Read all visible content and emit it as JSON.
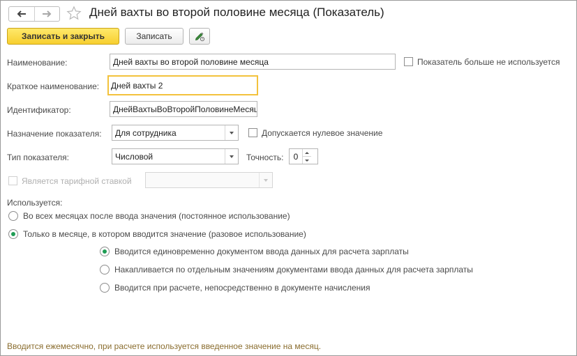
{
  "window": {
    "title": "Дней вахты во второй половине месяца (Показатель)"
  },
  "toolbar": {
    "save_close_label": "Записать и закрыть",
    "save_label": "Записать"
  },
  "form": {
    "name_label": "Наименование:",
    "name_value": "Дней вахты во второй половине месяца",
    "not_used_label": "Показатель больше не используется",
    "short_name_label": "Краткое наименование:",
    "short_name_value": "Дней вахты 2",
    "id_label": "Идентификатор:",
    "id_value": "ДнейВахтыВоВторойПоловинеМесяца",
    "purpose_label": "Назначение показателя:",
    "purpose_value": "Для сотрудника",
    "zero_allowed_label": "Допускается нулевое значение",
    "type_label": "Тип показателя:",
    "type_value": "Числовой",
    "precision_label": "Точность:",
    "precision_value": "0",
    "tariff_label": "Является тарифной ставкой",
    "tariff_value": "",
    "usage_label": "Используется:",
    "usage_options": [
      {
        "label": "Во всех месяцах после ввода значения (постоянное использование)",
        "selected": false
      },
      {
        "label": "Только в месяце, в котором вводится значение (разовое использование)",
        "selected": true
      }
    ],
    "input_options": [
      {
        "label": "Вводится единовременно документом ввода данных для расчета зарплаты",
        "selected": true
      },
      {
        "label": "Накапливается по отдельным значениям документами ввода данных для расчета зарплаты",
        "selected": false
      },
      {
        "label": "Вводится при расчете, непосредственно в документе начисления",
        "selected": false
      }
    ]
  },
  "footer": {
    "hint": "Вводится ежемесячно, при расчете используется введенное значение на месяц."
  },
  "colors": {
    "primary_button": "#f7cf2f",
    "focus_border": "#f3c23c",
    "radio_selected": "#1f9d55",
    "footer_text": "#8a6d2f"
  }
}
